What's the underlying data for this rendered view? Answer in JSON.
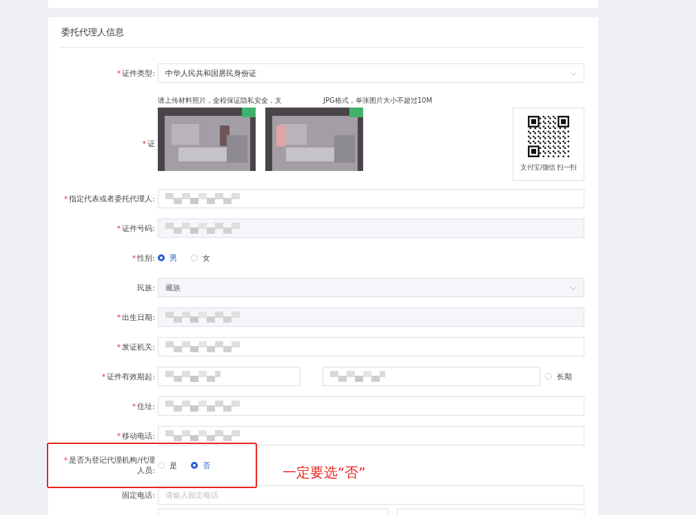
{
  "section": {
    "title": "委托代理人信息"
  },
  "fields": [
    {
      "kind": "select",
      "label": "证件类型:",
      "required_mark": "*",
      "value": "中华人民共和国居民身份证",
      "disabled": false
    },
    {
      "kind": "hint",
      "parts": [
        "请上传材料照片，全程保证隐私安全，支",
        "JPG格式，单张图片大小不超过10M"
      ]
    },
    {
      "kind": "upload",
      "label": "证",
      "required_mark": "*",
      "qr_caption": "支付宝/微信 扫一扫"
    },
    {
      "kind": "input",
      "label": "指定代表或者委托代理人:",
      "required_mark": "*",
      "value_redacted": true,
      "disabled": false
    },
    {
      "kind": "input",
      "label": "证件号码:",
      "required_mark": "*",
      "value_redacted": true,
      "disabled": true
    },
    {
      "kind": "radio",
      "label": "性别:",
      "required_mark": "*",
      "options": [
        {
          "label": "男",
          "selected": true
        },
        {
          "label": "女",
          "selected": false
        }
      ]
    },
    {
      "kind": "select",
      "label": "民族:",
      "value": "藏族",
      "disabled": true
    },
    {
      "kind": "input",
      "label": "出生日期:",
      "required_mark": "*",
      "value_redacted": true,
      "disabled": true
    },
    {
      "kind": "input",
      "label": "发证机关:",
      "required_mark": "*",
      "value_redacted": true,
      "disabled": false
    },
    {
      "kind": "date_range",
      "label": "证件有效期起:",
      "required_mark": "*",
      "start_redacted": true,
      "end_redacted": true,
      "long_term": {
        "label": "长期",
        "selected": false
      }
    },
    {
      "kind": "input",
      "label": "住址:",
      "required_mark": "*",
      "value_redacted": true,
      "disabled": false
    },
    {
      "kind": "input",
      "label": "移动电话:",
      "required_mark": "*",
      "value_redacted": true,
      "disabled": false
    },
    {
      "kind": "radio",
      "label": "是否为登记代理机构/代理人员:",
      "required_mark": "*",
      "options": [
        {
          "label": "是",
          "selected": false
        },
        {
          "label": "否",
          "selected": true
        }
      ]
    },
    {
      "kind": "input",
      "label": "固定电话:",
      "placeholder": "请输入固定电话"
    },
    {
      "kind": "split_input"
    }
  ],
  "annotation": {
    "text": "一定要选“否”"
  }
}
